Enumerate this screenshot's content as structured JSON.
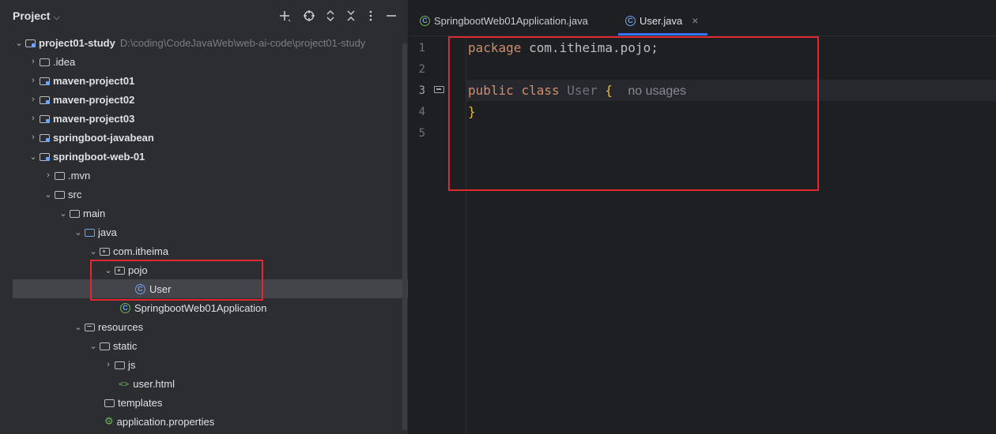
{
  "project_panel": {
    "title": "Project",
    "tools": [
      "add-icon",
      "target-icon",
      "expand-all-icon",
      "collapse-all-icon",
      "more-icon",
      "minimize-icon"
    ],
    "tree": [
      {
        "label": "project01-study",
        "hint": "D:\\coding\\CodeJavaWeb\\web-ai-code\\project01-study",
        "expanded": true,
        "bold": true,
        "icon": "module-folder-icon"
      },
      {
        "label": ".idea",
        "expanded": false,
        "icon": "folder-icon"
      },
      {
        "label": "maven-project01",
        "expanded": false,
        "bold": true,
        "icon": "module-folder-icon"
      },
      {
        "label": "maven-project02",
        "expanded": false,
        "bold": true,
        "icon": "module-folder-icon"
      },
      {
        "label": "maven-project03",
        "expanded": false,
        "bold": true,
        "icon": "module-folder-icon"
      },
      {
        "label": "springboot-javabean",
        "expanded": false,
        "bold": true,
        "icon": "module-folder-icon"
      },
      {
        "label": "springboot-web-01",
        "expanded": true,
        "bold": true,
        "icon": "module-folder-icon"
      },
      {
        "label": ".mvn",
        "expanded": false,
        "icon": "folder-icon"
      },
      {
        "label": "src",
        "expanded": true,
        "icon": "folder-icon"
      },
      {
        "label": "main",
        "expanded": true,
        "icon": "folder-icon"
      },
      {
        "label": "java",
        "expanded": true,
        "icon": "source-folder-icon"
      },
      {
        "label": "com.itheima",
        "expanded": true,
        "icon": "package-icon"
      },
      {
        "label": "pojo",
        "expanded": true,
        "icon": "package-icon"
      },
      {
        "label": "User",
        "icon": "class-icon",
        "selected": true
      },
      {
        "label": "SpringbootWeb01Application",
        "icon": "spring-class-icon"
      },
      {
        "label": "resources",
        "expanded": true,
        "icon": "resources-folder-icon"
      },
      {
        "label": "static",
        "expanded": true,
        "icon": "folder-icon"
      },
      {
        "label": "js",
        "expanded": false,
        "icon": "folder-icon"
      },
      {
        "label": "user.html",
        "icon": "html-file-icon"
      },
      {
        "label": "templates",
        "icon": "folder-icon"
      },
      {
        "label": "application.properties",
        "icon": "properties-file-icon"
      }
    ]
  },
  "editor": {
    "tabs": [
      {
        "label": "SpringbootWeb01Application.java",
        "icon": "spring-class-icon",
        "active": false
      },
      {
        "label": "User.java",
        "icon": "class-icon",
        "active": true
      }
    ],
    "close_glyph": "×",
    "line_numbers": [
      "1",
      "2",
      "3",
      "4",
      "5"
    ],
    "code": {
      "line1_kw": "package",
      "line1_rest": " com.itheima.pojo;",
      "line3_kw1": "public",
      "line3_kw2": "class",
      "line3_name": "User",
      "line3_brace": "{",
      "line3_inlay": "no usages",
      "line4_brace": "}"
    }
  },
  "colors": {
    "accent": "#3574f0",
    "highlight_box": "#e0282e",
    "keyword": "#cf8e6d",
    "brace": "#e8ba36"
  }
}
